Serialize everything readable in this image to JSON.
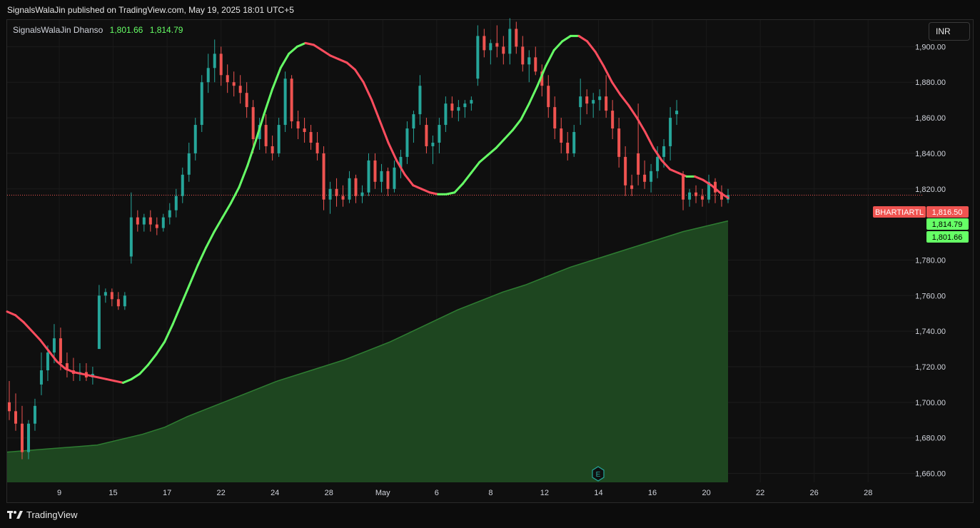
{
  "publish_line": "SignalsWalaJin published on TradingView.com, May 19, 2025 18:01 UTC+5",
  "legend": {
    "title": "SignalsWalaJin Dhanso",
    "value1": "1,801.66",
    "value2": "1,814.79"
  },
  "currency": "INR",
  "footer": {
    "brand": "TradingView"
  },
  "price_labels": {
    "ticker": "BHARTIARTL",
    "last": "1,816.50",
    "line2": "1,814.79",
    "line3": "1,801.66"
  },
  "earnings_marker": "E",
  "colors": {
    "up": "#26a69a",
    "down": "#ef5350",
    "ma_up": "#66ff66",
    "ma_down": "#ff4d5e",
    "fill": "#1e4620",
    "fill_line": "#2e7d32"
  },
  "chart_data": {
    "type": "candlestick",
    "x_tick_labels": [
      "9",
      "15",
      "17",
      "22",
      "24",
      "28",
      "May",
      "6",
      "8",
      "12",
      "14",
      "16",
      "20",
      "22",
      "26",
      "28"
    ],
    "y_tick_labels": [
      "1,900.00",
      "1,880.00",
      "1,860.00",
      "1,840.00",
      "1,820.00",
      "1,780.00",
      "1,760.00",
      "1,740.00",
      "1,720.00",
      "1,700.00",
      "1,680.00",
      "1,660.00"
    ],
    "ylim": [
      1655,
      1915
    ],
    "last_price": 1816.5,
    "ohlc": [
      [
        1700,
        1712,
        1690,
        1695
      ],
      [
        1695,
        1705,
        1684,
        1688
      ],
      [
        1688,
        1698,
        1668,
        1672
      ],
      [
        1672,
        1690,
        1668,
        1688
      ],
      [
        1688,
        1702,
        1684,
        1698
      ],
      [
        1710,
        1728,
        1704,
        1718
      ],
      [
        1718,
        1732,
        1712,
        1728
      ],
      [
        1728,
        1744,
        1722,
        1736
      ],
      [
        1736,
        1742,
        1718,
        1722
      ],
      [
        1722,
        1728,
        1714,
        1718
      ],
      [
        1718,
        1725,
        1712,
        1716
      ],
      [
        1716,
        1722,
        1712,
        1717
      ],
      [
        1717,
        1722,
        1712,
        1714
      ],
      [
        1714,
        1720,
        1710,
        1716
      ],
      [
        1730,
        1766,
        1730,
        1760
      ],
      [
        1760,
        1764,
        1756,
        1762
      ],
      [
        1762,
        1764,
        1754,
        1758
      ],
      [
        1758,
        1762,
        1752,
        1754
      ],
      [
        1754,
        1762,
        1752,
        1760
      ],
      [
        1782,
        1818,
        1778,
        1804
      ],
      [
        1804,
        1808,
        1796,
        1800
      ],
      [
        1800,
        1806,
        1796,
        1804
      ],
      [
        1804,
        1808,
        1796,
        1800
      ],
      [
        1800,
        1804,
        1794,
        1798
      ],
      [
        1798,
        1806,
        1796,
        1804
      ],
      [
        1804,
        1812,
        1800,
        1808
      ],
      [
        1808,
        1820,
        1804,
        1816
      ],
      [
        1816,
        1832,
        1812,
        1828
      ],
      [
        1828,
        1846,
        1824,
        1840
      ],
      [
        1840,
        1860,
        1836,
        1856
      ],
      [
        1856,
        1884,
        1852,
        1880
      ],
      [
        1880,
        1896,
        1874,
        1888
      ],
      [
        1888,
        1904,
        1880,
        1896
      ],
      [
        1896,
        1900,
        1878,
        1884
      ],
      [
        1884,
        1890,
        1874,
        1880
      ],
      [
        1880,
        1886,
        1872,
        1878
      ],
      [
        1878,
        1884,
        1868,
        1874
      ],
      [
        1874,
        1880,
        1860,
        1866
      ],
      [
        1866,
        1870,
        1840,
        1848
      ],
      [
        1848,
        1860,
        1842,
        1856
      ],
      [
        1856,
        1862,
        1840,
        1844
      ],
      [
        1844,
        1850,
        1836,
        1840
      ],
      [
        1840,
        1860,
        1838,
        1856
      ],
      [
        1856,
        1886,
        1852,
        1882
      ],
      [
        1882,
        1884,
        1854,
        1858
      ],
      [
        1858,
        1864,
        1848,
        1854
      ],
      [
        1854,
        1860,
        1846,
        1852
      ],
      [
        1852,
        1856,
        1842,
        1846
      ],
      [
        1846,
        1852,
        1836,
        1840
      ],
      [
        1840,
        1844,
        1808,
        1814
      ],
      [
        1814,
        1824,
        1806,
        1820
      ],
      [
        1820,
        1826,
        1810,
        1816
      ],
      [
        1816,
        1822,
        1810,
        1814
      ],
      [
        1814,
        1830,
        1812,
        1826
      ],
      [
        1826,
        1828,
        1812,
        1816
      ],
      [
        1816,
        1822,
        1812,
        1818
      ],
      [
        1818,
        1840,
        1816,
        1836
      ],
      [
        1836,
        1840,
        1820,
        1824
      ],
      [
        1824,
        1834,
        1818,
        1830
      ],
      [
        1830,
        1832,
        1816,
        1820
      ],
      [
        1820,
        1836,
        1818,
        1832
      ],
      [
        1832,
        1842,
        1826,
        1838
      ],
      [
        1838,
        1858,
        1834,
        1854
      ],
      [
        1854,
        1864,
        1846,
        1862
      ],
      [
        1862,
        1884,
        1856,
        1878
      ],
      [
        1856,
        1860,
        1840,
        1844
      ],
      [
        1844,
        1850,
        1834,
        1846
      ],
      [
        1846,
        1860,
        1840,
        1856
      ],
      [
        1856,
        1872,
        1852,
        1868
      ],
      [
        1868,
        1872,
        1860,
        1864
      ],
      [
        1864,
        1870,
        1858,
        1866
      ],
      [
        1866,
        1870,
        1860,
        1868
      ],
      [
        1868,
        1872,
        1864,
        1870
      ],
      [
        1882,
        1912,
        1878,
        1906
      ],
      [
        1906,
        1910,
        1894,
        1898
      ],
      [
        1898,
        1904,
        1890,
        1902
      ],
      [
        1902,
        1912,
        1894,
        1900
      ],
      [
        1900,
        1906,
        1890,
        1896
      ],
      [
        1896,
        1916,
        1890,
        1910
      ],
      [
        1910,
        1914,
        1896,
        1900
      ],
      [
        1900,
        1906,
        1886,
        1890
      ],
      [
        1890,
        1898,
        1880,
        1894
      ],
      [
        1894,
        1900,
        1884,
        1886
      ],
      [
        1886,
        1890,
        1872,
        1878
      ],
      [
        1878,
        1884,
        1860,
        1866
      ],
      [
        1866,
        1872,
        1848,
        1854
      ],
      [
        1854,
        1860,
        1840,
        1846
      ],
      [
        1846,
        1852,
        1836,
        1840
      ],
      [
        1840,
        1856,
        1838,
        1852
      ],
      [
        1866,
        1882,
        1856,
        1872
      ],
      [
        1872,
        1876,
        1862,
        1868
      ],
      [
        1868,
        1874,
        1860,
        1870
      ],
      [
        1870,
        1876,
        1864,
        1872
      ],
      [
        1872,
        1884,
        1860,
        1864
      ],
      [
        1864,
        1870,
        1848,
        1854
      ],
      [
        1854,
        1860,
        1832,
        1838
      ],
      [
        1838,
        1844,
        1816,
        1822
      ],
      [
        1822,
        1828,
        1816,
        1820
      ],
      [
        1840,
        1868,
        1822,
        1828
      ],
      [
        1828,
        1836,
        1820,
        1824
      ],
      [
        1824,
        1834,
        1818,
        1830
      ],
      [
        1830,
        1844,
        1826,
        1838
      ],
      [
        1838,
        1848,
        1832,
        1844
      ],
      [
        1844,
        1866,
        1836,
        1860
      ],
      [
        1862,
        1870,
        1856,
        1864
      ],
      [
        1828,
        1830,
        1808,
        1814
      ],
      [
        1814,
        1820,
        1810,
        1818
      ],
      [
        1818,
        1822,
        1812,
        1816
      ],
      [
        1816,
        1820,
        1810,
        1814
      ],
      [
        1814,
        1828,
        1812,
        1824
      ],
      [
        1824,
        1826,
        1812,
        1818
      ],
      [
        1818,
        1822,
        1810,
        1814
      ],
      [
        1814,
        1820,
        1812,
        1816.5
      ]
    ],
    "ma_line": [
      1751,
      1749,
      1745,
      1740,
      1735,
      1729,
      1723,
      1719,
      1717,
      1716,
      1715,
      1714,
      1713,
      1712,
      1711,
      1713,
      1716,
      1721,
      1727,
      1734,
      1744,
      1755,
      1766,
      1777,
      1787,
      1796,
      1804,
      1812,
      1821,
      1833,
      1847,
      1862,
      1876,
      1888,
      1896,
      1900,
      1902,
      1901,
      1898,
      1895,
      1893,
      1891,
      1887,
      1880,
      1870,
      1858,
      1846,
      1836,
      1828,
      1822,
      1820,
      1818,
      1817,
      1817,
      1818,
      1823,
      1829,
      1835,
      1839,
      1843,
      1848,
      1853,
      1859,
      1868,
      1878,
      1889,
      1898,
      1903,
      1906,
      1906,
      1903,
      1897,
      1889,
      1880,
      1873,
      1867,
      1860,
      1852,
      1843,
      1836,
      1831,
      1829,
      1827,
      1827,
      1825,
      1822,
      1818,
      1815
    ],
    "ma_fill": [
      1672,
      1673,
      1674,
      1675,
      1676,
      1679,
      1682,
      1686,
      1692,
      1697,
      1702,
      1707,
      1712,
      1716,
      1720,
      1724,
      1729,
      1734,
      1740,
      1746,
      1752,
      1757,
      1762,
      1766,
      1771,
      1776,
      1780,
      1784,
      1788,
      1792,
      1796,
      1799,
      1802
    ]
  }
}
